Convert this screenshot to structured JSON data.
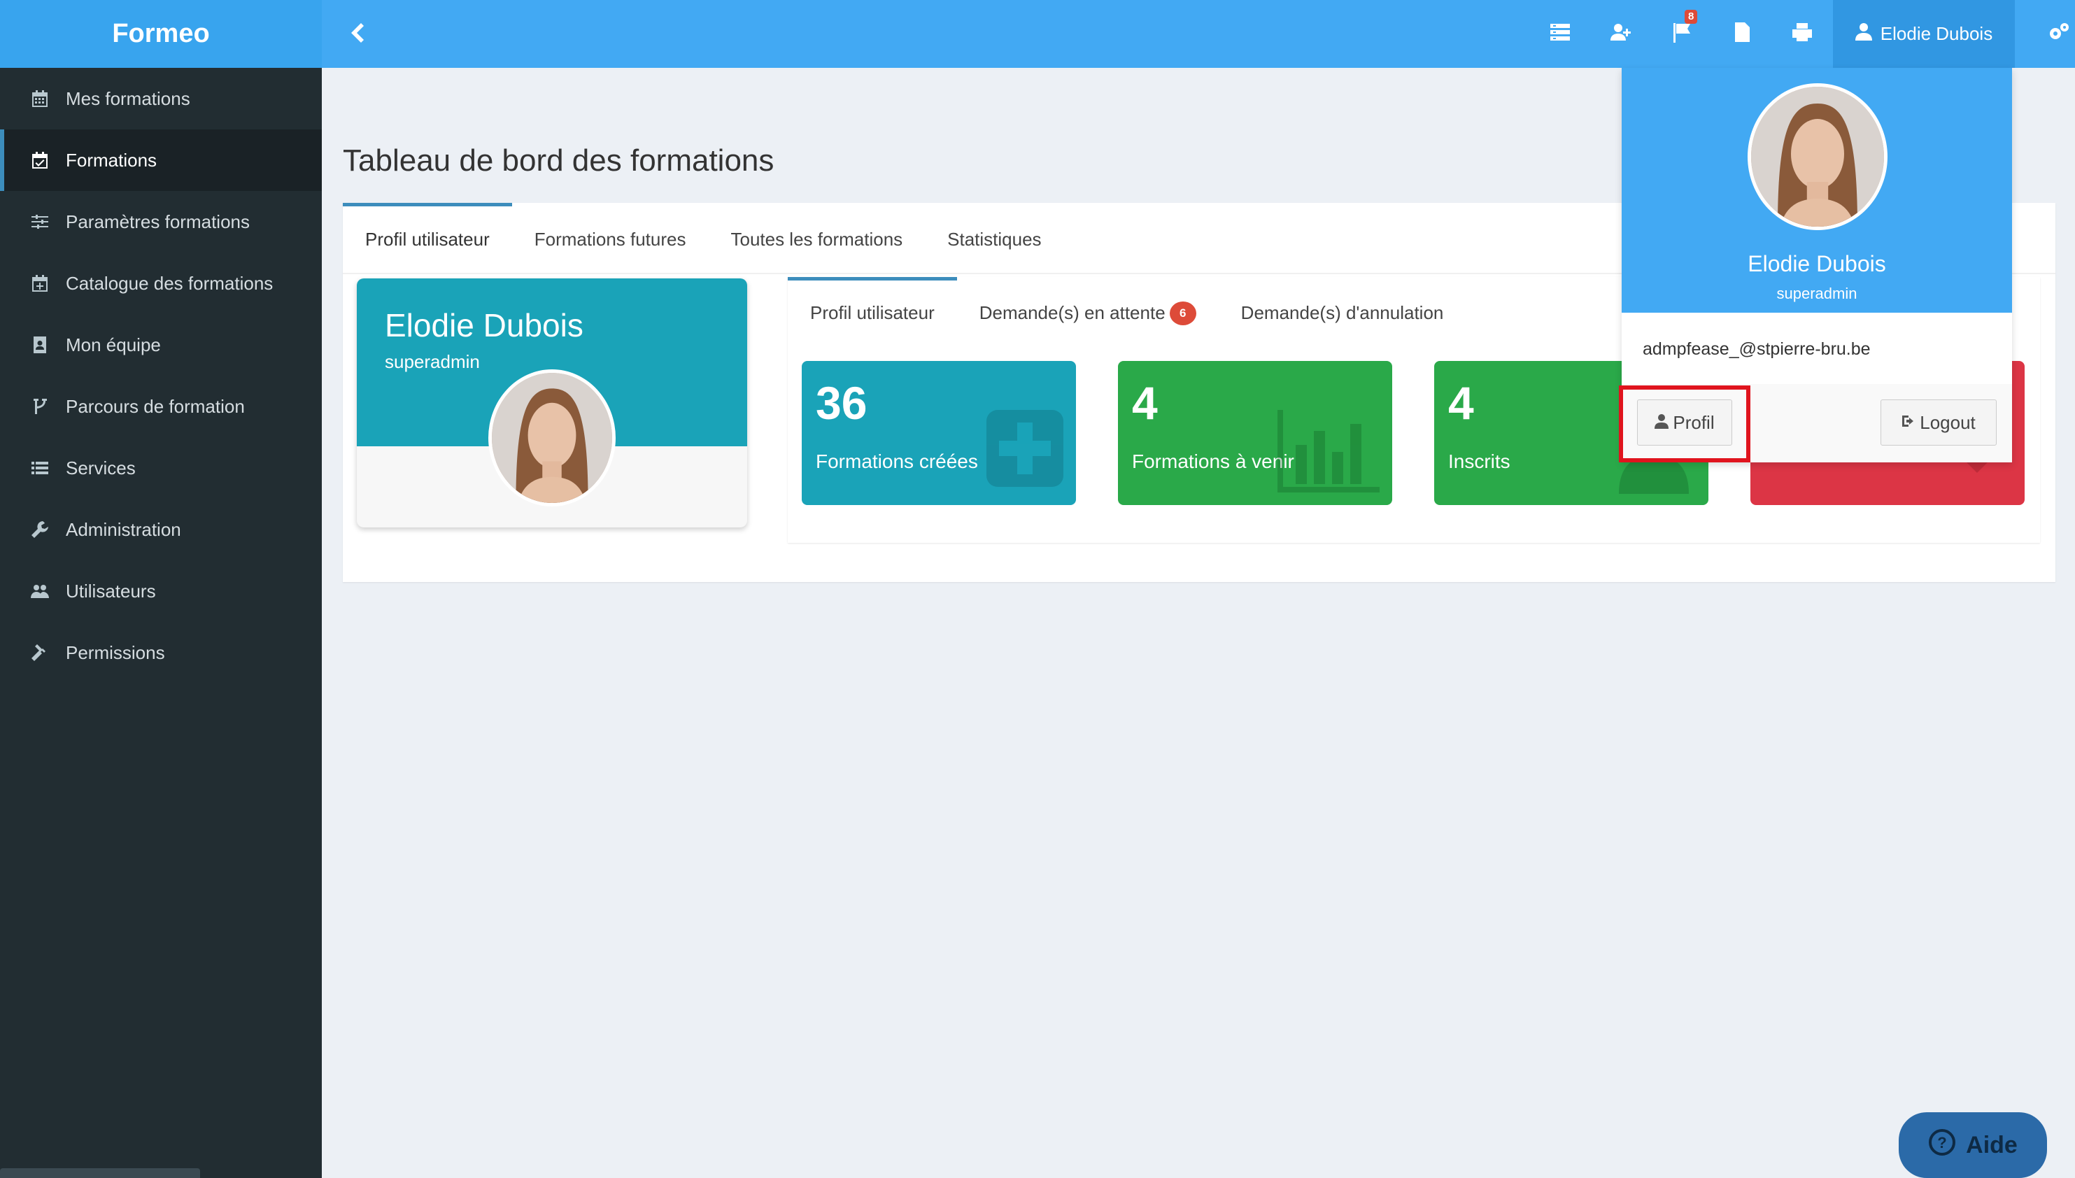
{
  "app": {
    "brand": "Formeo"
  },
  "sidebar": {
    "items": [
      {
        "label": "Mes formations",
        "icon": "calendar-icon",
        "active": false
      },
      {
        "label": "Formations",
        "icon": "calendar-check-icon",
        "active": true
      },
      {
        "label": "Paramètres formations",
        "icon": "sliders-icon",
        "active": false
      },
      {
        "label": "Catalogue des formations",
        "icon": "calendar-plus-icon",
        "active": false
      },
      {
        "label": "Mon équipe",
        "icon": "address-book-icon",
        "active": false
      },
      {
        "label": "Parcours de formation",
        "icon": "code-fork-icon",
        "active": false
      },
      {
        "label": "Services",
        "icon": "list-icon",
        "active": false
      },
      {
        "label": "Administration",
        "icon": "wrench-icon",
        "active": false
      },
      {
        "label": "Utilisateurs",
        "icon": "users-icon",
        "active": false
      },
      {
        "label": "Permissions",
        "icon": "gavel-icon",
        "active": false
      }
    ]
  },
  "topbar": {
    "notifications_count": "8",
    "user_name": "Elodie Dubois"
  },
  "page": {
    "title": "Tableau de bord des formations",
    "tabs": [
      "Profil utilisateur",
      "Formations futures",
      "Toutes les formations",
      "Statistiques"
    ]
  },
  "profile": {
    "name": "Elodie Dubois",
    "role": "superadmin"
  },
  "inner": {
    "tabs": [
      "Profil utilisateur",
      "Demande(s) en attente",
      "Demande(s) d'annulation"
    ],
    "pending_count": "6"
  },
  "tiles": [
    {
      "value": "36",
      "label": "Formations créées",
      "color": "#1aa3b8"
    },
    {
      "value": "4",
      "label": "Formations à venir",
      "color": "#2aa949"
    },
    {
      "value": "4",
      "label": "Inscrits",
      "color": "#2aa949"
    },
    {
      "value": "",
      "label": "",
      "color": "#dc3545"
    }
  ],
  "dropdown": {
    "name": "Elodie Dubois",
    "role": "superadmin",
    "email": "admpfease_@stpierre-bru.be",
    "profile_button": "Profil",
    "logout_button": "Logout"
  },
  "help": {
    "label": "Aide"
  },
  "colors": {
    "topbar": "#42a9f3",
    "sidebar": "#222d32",
    "highlight": "#e0141e"
  }
}
